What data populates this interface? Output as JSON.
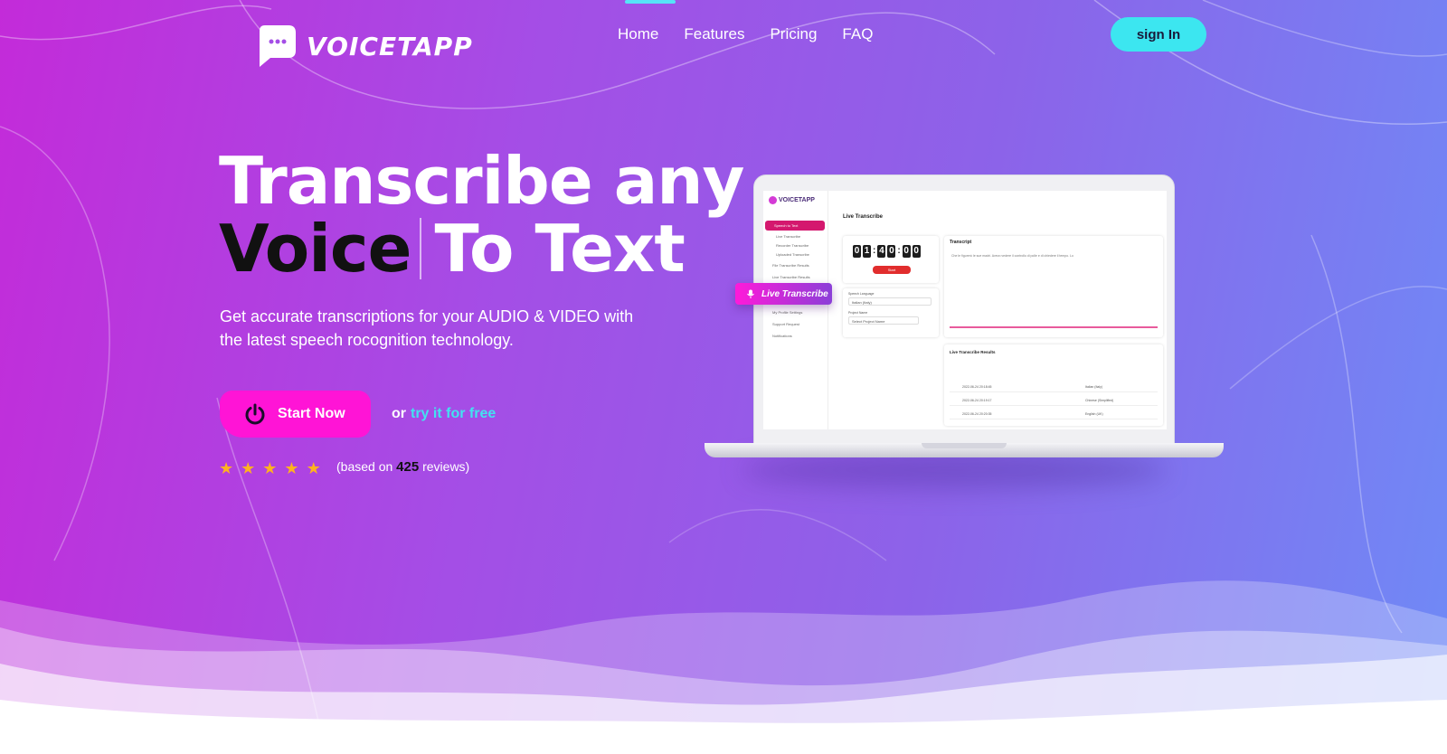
{
  "brand": {
    "name": "VOICETAPP"
  },
  "nav": {
    "items": [
      {
        "label": "Home",
        "active": true
      },
      {
        "label": "Features",
        "active": false
      },
      {
        "label": "Pricing",
        "active": false
      },
      {
        "label": "FAQ",
        "active": false
      }
    ],
    "signin_label": "sign In"
  },
  "hero": {
    "headline_line1": "Transcribe any",
    "headline_word_dark": "Voice",
    "headline_rest": "To Text",
    "subtitle": "Get accurate transcriptions for your AUDIO & VIDEO with the latest speech rocognition technology.",
    "start_label": "Start Now",
    "or_label": "or",
    "try_label": "try it for free",
    "rating": {
      "stars": 5,
      "prefix": "(based on",
      "count": "425",
      "suffix": "reviews)"
    }
  },
  "mockup": {
    "badge_label": "Live Transcribe",
    "app_logo": "VOICETAPP",
    "sidebar_active": "Speech to Text",
    "sidebar_items": [
      "Live Transcribe",
      "Recorder Transcribe",
      "Uploaded Transcribe",
      "File Transcribe Results",
      "Live Transcribe Results",
      "My Profile Settings",
      "Support Request",
      "Notifications"
    ],
    "page_title": "Live Transcribe",
    "timer_digits": [
      "0",
      "1",
      "4",
      "0",
      "0",
      "0"
    ],
    "start_label": "Start",
    "speech_language_label": "Speech Language",
    "speech_language_value": "Italian (Italy)",
    "project_label": "Project Name",
    "project_placeholder": "Select Project Name",
    "transcript_title": "Transcript",
    "transcript_text": "Che le figurerò le sue madri. Avevo vedere il controllo di polle e di chiedere il tempo. Lo",
    "results_title": "Live Transcribe Results",
    "results_rows": [
      {
        "date": "2022-06-24 20:18:45",
        "language": "Italian (Italy)"
      },
      {
        "date": "2022-06-24 20:19:17",
        "language": "Chinese (Simplified)"
      },
      {
        "date": "2022-06-24 20:20:35",
        "language": "English (UK)"
      }
    ]
  },
  "colors": {
    "gradient_start": "#c32bd9",
    "gradient_end": "#6f8af6",
    "accent_cyan": "#3ce6f0",
    "accent_pink": "#ff14d6",
    "star": "#ffb21f"
  }
}
